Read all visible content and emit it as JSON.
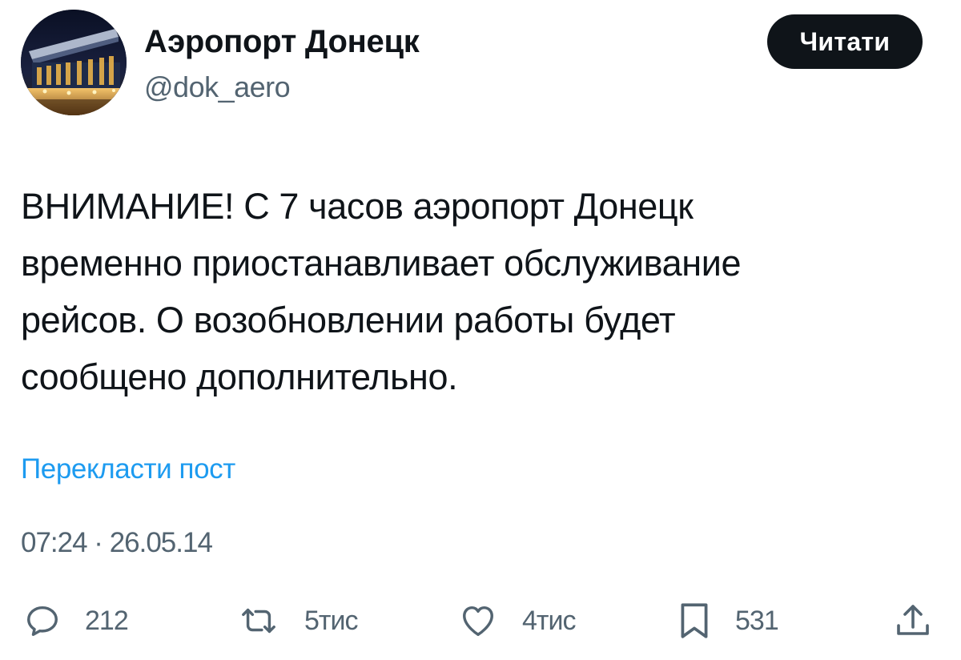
{
  "author": {
    "name": "Аэропорт Донецк",
    "handle": "@dok_aero",
    "follow_label": "Читати"
  },
  "tweet": {
    "text_lines": [
      "ВНИМАНИЕ! С 7 часов аэропорт Донецк",
      "временно приостанавливает обслуживание",
      "рейсов. О возобновлении работы будет",
      "сообщено дополнительно."
    ],
    "translate_label": "Перекласти пост",
    "timestamp": "07:24 · 26.05.14"
  },
  "actions": {
    "reply": {
      "icon": "reply-icon",
      "count": "212"
    },
    "retweet": {
      "icon": "retweet-icon",
      "count": "5тис"
    },
    "like": {
      "icon": "heart-icon",
      "count": "4тис"
    },
    "bookmark": {
      "icon": "bookmark-icon",
      "count": "531"
    },
    "share": {
      "icon": "share-icon"
    }
  },
  "colors": {
    "text": "#0f1419",
    "secondary": "#536471",
    "link": "#1d9bf0",
    "button_bg": "#0f1419",
    "button_text": "#ffffff"
  }
}
